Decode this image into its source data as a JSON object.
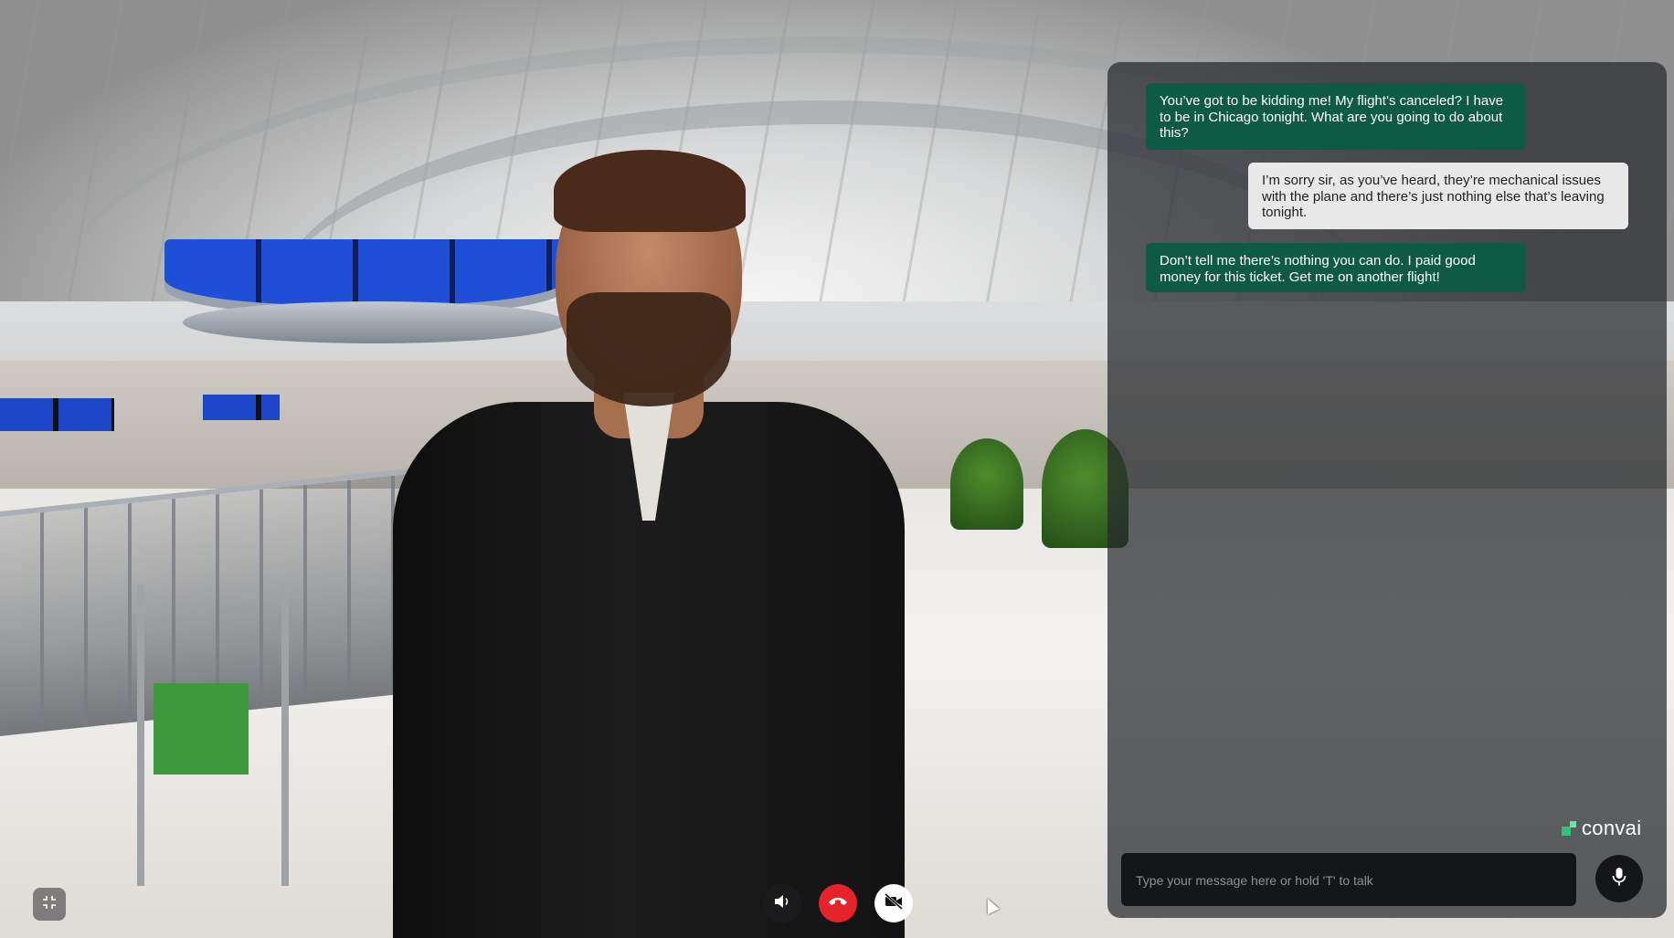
{
  "scene": {
    "background": "airport terminal",
    "character": "avatar"
  },
  "chat": {
    "messages": [
      {
        "role": "user",
        "text": "You’ve got to be kidding me! My flight’s canceled? I have to be in Chicago tonight. What are you going to do about this?"
      },
      {
        "role": "character",
        "text": "I’m sorry sir, as you’ve heard, they’re mechanical issues with the plane and there’s just nothing else that’s leaving tonight."
      },
      {
        "role": "user",
        "text": "Don’t tell me there’s nothing you can do. I paid good money for this ticket. Get me on another flight!"
      }
    ],
    "user_bubble_color": "#0f5a45",
    "character_bubble_color": "#e8e8e8",
    "brand": "convai",
    "brand_color": "#34c27a",
    "input": {
      "placeholder": "Type your message here or hold 'T' to talk",
      "value": ""
    },
    "mic_icon": "microphone-icon"
  },
  "controls": {
    "exit_fullscreen_icon": "exit-fullscreen-icon",
    "speaker_icon": "speaker-icon",
    "hangup_icon": "phone-hangup-icon",
    "hangup_color": "#e42428",
    "video_icon": "video-off-icon"
  }
}
